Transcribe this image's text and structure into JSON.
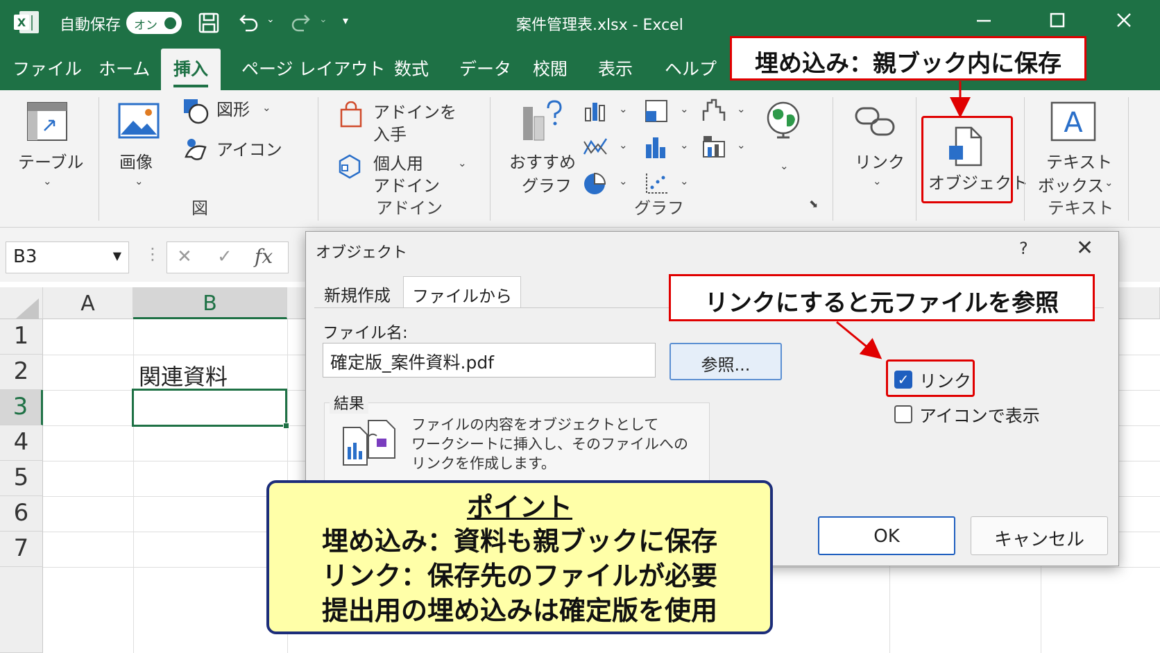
{
  "titlebar": {
    "autosave_label": "自動保存",
    "toggle_label": "オン",
    "title": "案件管理表.xlsx  -  Excel",
    "colors": {
      "excel_green": "#1e7145"
    }
  },
  "tabs": [
    "ファイル",
    "ホーム",
    "挿入",
    "ページ レイアウト",
    "数式",
    "データ",
    "校閲",
    "表示",
    "ヘルプ"
  ],
  "active_tab": "挿入",
  "ribbon": {
    "table_label": "テーブル",
    "image_label": "画像",
    "shapes_label": "図形",
    "icons_label": "アイコン",
    "group_figure": "図",
    "addin_get_1": "アドインを",
    "addin_get_2": "入手",
    "addin_personal_1": "個人用",
    "addin_personal_2": "アドイン",
    "group_addin": "アドイン",
    "rec_chart_1": "おすすめ",
    "rec_chart_2": "グラフ",
    "group_chart": "グラフ",
    "link_label": "リンク",
    "object_label": "オブジェクト",
    "textbox_1": "テキスト",
    "textbox_2": "ボックス",
    "group_text": "テキスト"
  },
  "formula_bar": {
    "name_box": "B3",
    "fx": "fx"
  },
  "sheet": {
    "columns": [
      "A",
      "B"
    ],
    "rows": [
      "1",
      "2",
      "3",
      "4",
      "5",
      "6",
      "7"
    ],
    "b2_value": "関連資料",
    "selected_cell": "B3"
  },
  "dialog": {
    "title": "オブジェクト",
    "help": "?",
    "close": "✕",
    "tab_new": "新規作成",
    "tab_from_file": "ファイルから",
    "file_name_label": "ファイル名:",
    "file_name_value": "確定版_案件資料.pdf",
    "browse_button": "参照...",
    "link_checkbox": "リンク",
    "link_checked": true,
    "icon_checkbox": "アイコンで表示",
    "icon_checked": false,
    "result_label": "結果",
    "result_line1": "ファイルの内容をオブジェクトとして",
    "result_line2": "ワークシートに挿入し、そのファイルへの",
    "result_line3": "リンクを作成します。",
    "ok_button": "OK",
    "cancel_button": "キャンセル"
  },
  "callouts": {
    "embed": "埋め込み：親ブック内に保存",
    "link": "リンクにすると元ファイルを参照"
  },
  "point": {
    "heading": "ポイント",
    "line1": "埋め込み：資料も親ブックに保存",
    "line2": "リンク：保存先のファイルが必要",
    "line3": "提出用の埋め込みは確定版を使用"
  }
}
